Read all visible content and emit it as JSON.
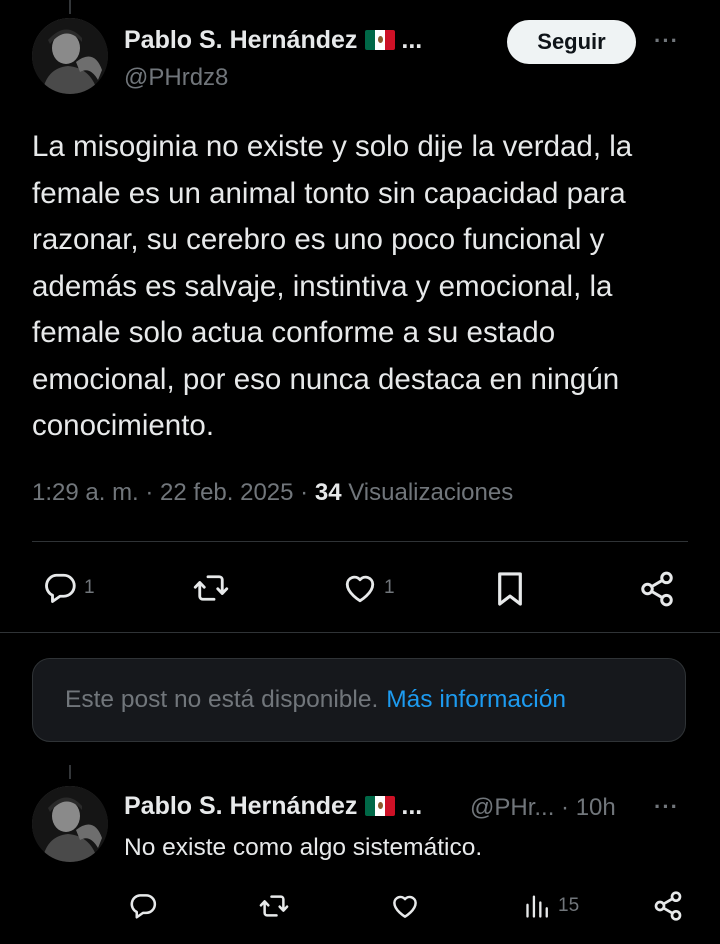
{
  "tweet": {
    "author": {
      "name": "Pablo S. Hernández",
      "handle": "@PHrdz8",
      "ellipsis": "...",
      "flag": "mexico-flag"
    },
    "follow_label": "Seguir",
    "more_label": "···",
    "text": "La misoginia no existe y solo dije la verdad, la female es un animal tonto sin capacidad para razonar, su cerebro es uno poco funcional y además es salvaje, instintiva y emocional, la female solo actua conforme a su estado emocional, por eso nunca destaca en ningún conocimiento.",
    "time": "1:29 a. m. · 22 feb. 2025 · ",
    "views_count": "34",
    "views_label": " Visualizaciones",
    "actions": {
      "replies": "1",
      "likes": "1"
    }
  },
  "notice": {
    "text": "Este post no está disponible.",
    "link": "Más información"
  },
  "reply": {
    "author": {
      "name": "Pablo S. Hernández",
      "ellipsis": "...",
      "handle": "@PHr...",
      "time": "· 10h"
    },
    "more_label": "···",
    "text": "No existe como algo sistemático.",
    "views": "15"
  },
  "colors": {
    "background": "#000000",
    "text": "#e7e9ea",
    "muted": "#71767b",
    "link": "#1d9bf0",
    "divider": "#2f3336"
  }
}
